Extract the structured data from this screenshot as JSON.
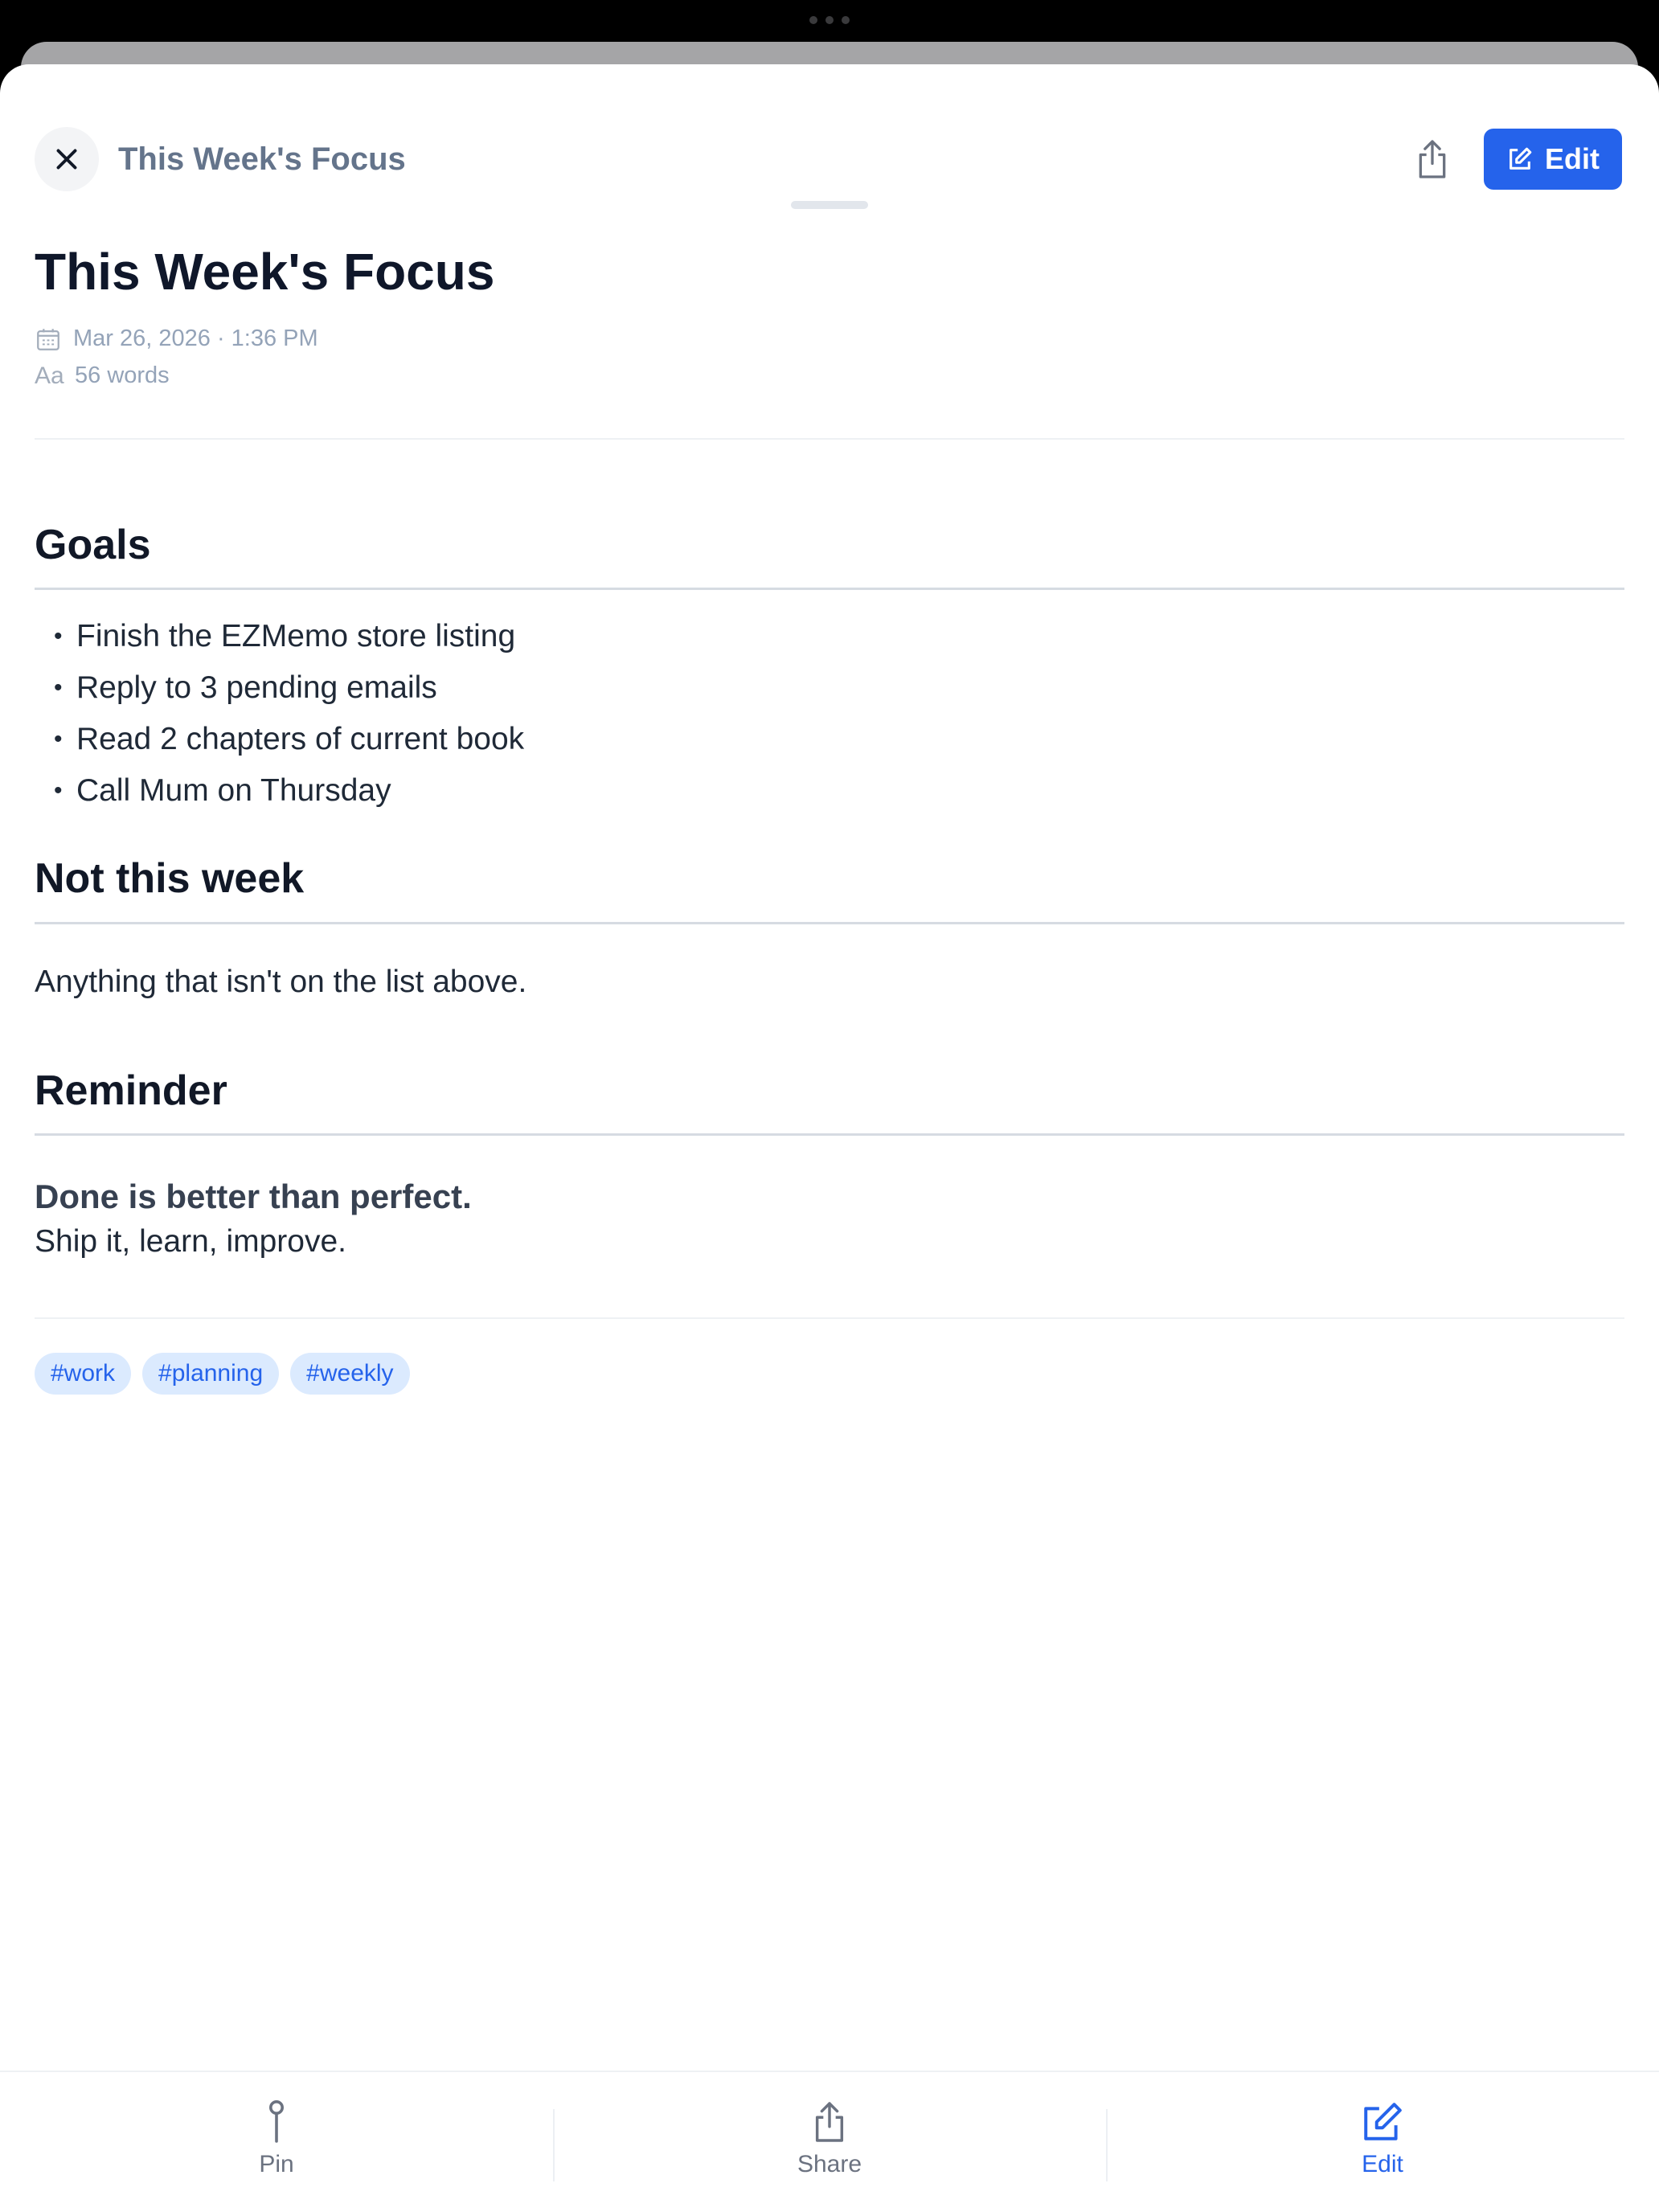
{
  "header": {
    "title": "This Week's Focus",
    "edit_label": "Edit"
  },
  "note": {
    "title": "This Week's Focus",
    "date": "Mar 26, 2026 · 1:36 PM",
    "word_count_icon": "Aa",
    "word_count": "56 words",
    "sections": {
      "goals": {
        "heading": "Goals",
        "items": [
          "Finish the EZMemo store listing",
          "Reply to 3 pending emails",
          "Read 2 chapters of current book",
          "Call Mum on Thursday"
        ]
      },
      "not_this_week": {
        "heading": "Not this week",
        "text": "Anything that isn't on the list above."
      },
      "reminder": {
        "heading": "Reminder",
        "bold_text": "Done is better than perfect.",
        "text": "Ship it, learn, improve."
      }
    },
    "tags": [
      "#work",
      "#planning",
      "#weekly"
    ]
  },
  "bottom_bar": {
    "pin_label": "Pin",
    "share_label": "Share",
    "edit_label": "Edit"
  },
  "colors": {
    "accent": "#2563eb",
    "tag_bg": "#dbeafe",
    "title_text": "#0f172a",
    "muted": "#94a3b8"
  },
  "icons": {
    "close": "close-icon",
    "share": "share-icon",
    "edit": "edit-icon",
    "calendar": "calendar-icon",
    "pin": "pin-icon"
  }
}
